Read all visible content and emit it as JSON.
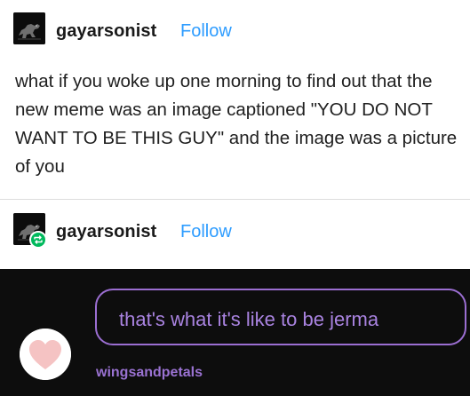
{
  "original_post": {
    "username": "gayarsonist",
    "follow_label": "Follow",
    "text": "what if you woke up one morning to find out that the new meme was an image captioned \"YOU DO NOT WANT TO BE THIS GUY\" and the image was a picture of you"
  },
  "reblog": {
    "username": "gayarsonist",
    "follow_label": "Follow"
  },
  "image": {
    "message": "that's what it's like to be jerma",
    "commenter": "wingsandpetals"
  },
  "icons": {
    "avatar": "dinosaur-avatar-icon",
    "reblog": "reblog-icon",
    "commenter_avatar": "heart-avatar-icon"
  },
  "colors": {
    "follow": "#2d9cff",
    "reblog_badge": "#00b95c",
    "bubble_border": "#9b6ed1",
    "bubble_text": "#a983e0",
    "commenter": "#9a72d2",
    "image_bg": "#0d0d0d"
  }
}
